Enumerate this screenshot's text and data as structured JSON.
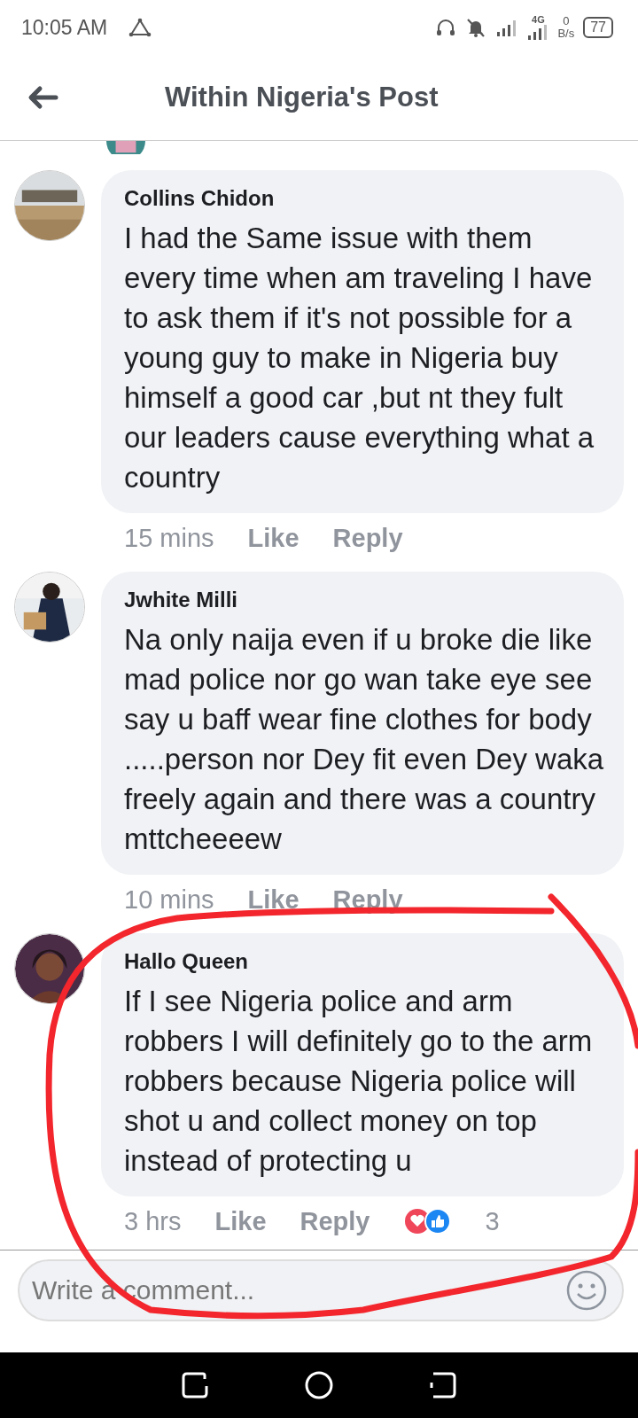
{
  "status_bar": {
    "time": "10:05 AM",
    "network_label": "4G",
    "speed_value": "0",
    "speed_unit": "B/s",
    "battery": "77"
  },
  "header": {
    "title": "Within Nigeria's Post"
  },
  "comments": [
    {
      "name": "Collins Chidon",
      "text": "I had the Same issue with them every time when am traveling I have to ask them if it's not possible for a young guy to make in Nigeria buy himself a good car ,but nt they fult our leaders cause everything what a country",
      "time": "15 mins",
      "like": "Like",
      "reply": "Reply"
    },
    {
      "name": "Jwhite Milli",
      "text": "Na only naija even if u broke die like mad police nor go wan take eye see say u baff wear fine clothes for body .....person nor Dey fit even Dey waka freely again and there was a country mttcheeeew",
      "time": "10 mins",
      "like": "Like",
      "reply": "Reply"
    },
    {
      "name": "Hallo Queen",
      "text": "If I see Nigeria police and arm robbers I will definitely go to the arm robbers because Nigeria police will shot u and collect money on top instead of protecting u",
      "time": "3 hrs",
      "like": "Like",
      "reply": "Reply",
      "reactions": "3"
    }
  ],
  "composer": {
    "placeholder": "Write a comment..."
  }
}
